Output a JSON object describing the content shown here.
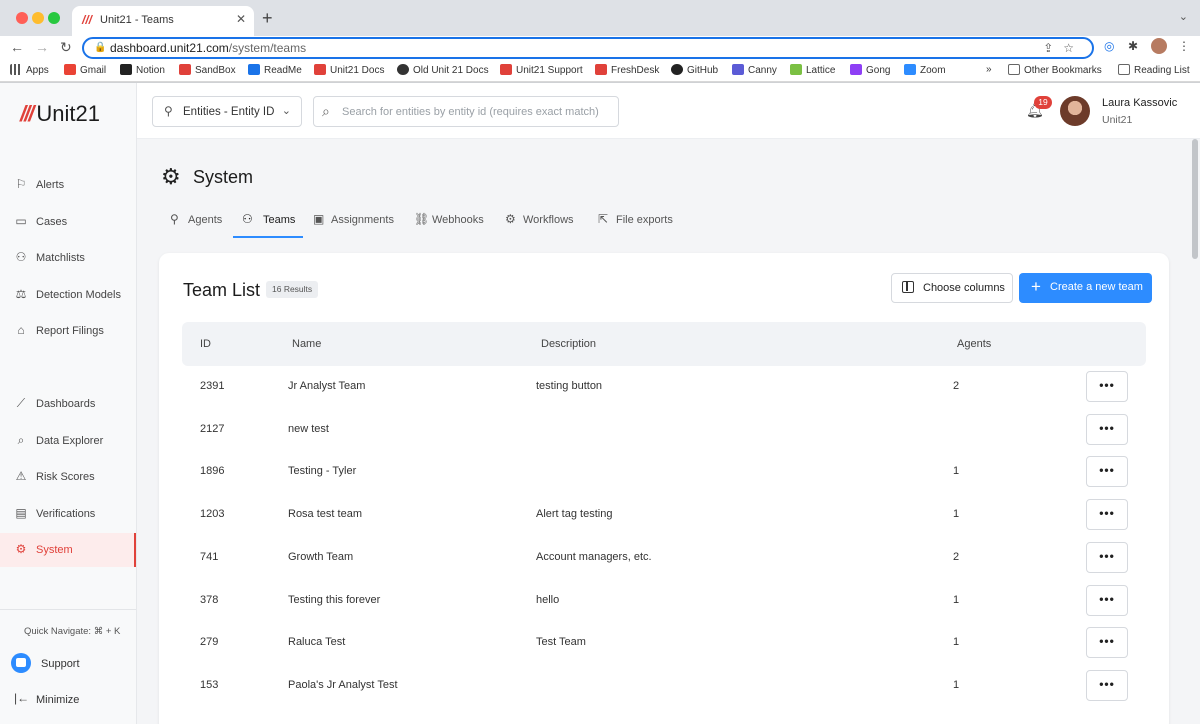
{
  "browser": {
    "tab_title": "Unit21 - Teams",
    "tab_favicon": "///",
    "new_tab": "+",
    "tab_close": "✕",
    "tab_menu": "⌄",
    "url_host": "dashboard.unit21.com",
    "url_path": "/system/teams",
    "bookmarks": [
      {
        "label": "Apps",
        "color": "#4285f4"
      },
      {
        "label": "Gmail",
        "color": "#ea4335"
      },
      {
        "label": "Notion",
        "color": "#222222"
      },
      {
        "label": "SandBox",
        "color": "#e0413a"
      },
      {
        "label": "ReadMe",
        "color": "#1a73e8"
      },
      {
        "label": "Unit21 Docs",
        "color": "#e0413a"
      },
      {
        "label": "Old Unit 21 Docs",
        "color": "#333333"
      },
      {
        "label": "Unit21 Support",
        "color": "#e0413a"
      },
      {
        "label": "FreshDesk",
        "color": "#e0413a"
      },
      {
        "label": "GitHub",
        "color": "#222222"
      },
      {
        "label": "Canny",
        "color": "#5b5bd6"
      },
      {
        "label": "Lattice",
        "color": "#7bc043"
      },
      {
        "label": "Gong",
        "color": "#8e3ff5"
      },
      {
        "label": "Zoom",
        "color": "#2d8cff"
      }
    ],
    "bookmarks_overflow": "»",
    "other_bookmarks": "Other Bookmarks",
    "reading_list": "Reading List"
  },
  "app": {
    "logo_text": "Unit21",
    "logo_mark": "///",
    "accent": "#e0413a",
    "primary": "#2d8cff"
  },
  "sidebar": {
    "items_top": [
      {
        "label": "Alerts",
        "icon": "flag-icon"
      },
      {
        "label": "Cases",
        "icon": "briefcase-icon"
      },
      {
        "label": "Matchlists",
        "icon": "user-plus-icon"
      },
      {
        "label": "Detection Models",
        "icon": "scale-icon"
      },
      {
        "label": "Report Filings",
        "icon": "bank-icon"
      }
    ],
    "items_bottom": [
      {
        "label": "Dashboards",
        "icon": "chart-line-icon"
      },
      {
        "label": "Data Explorer",
        "icon": "search-list-icon"
      },
      {
        "label": "Risk Scores",
        "icon": "warning-icon"
      },
      {
        "label": "Verifications",
        "icon": "id-card-icon"
      },
      {
        "label": "System",
        "icon": "gear-icon",
        "active": true
      }
    ],
    "quick_navigate": "Quick Navigate: ⌘ + K",
    "support": "Support",
    "minimize": "Minimize"
  },
  "header": {
    "entity_select": "Entities - Entity ID",
    "search_placeholder": "Search for entities by entity id (requires exact match)",
    "notifications_count": "19",
    "user_name": "Laura Kassovic",
    "user_org": "Unit21"
  },
  "page": {
    "title": "System",
    "tabs": [
      "Agents",
      "Teams",
      "Assignments",
      "Webhooks",
      "Workflows",
      "File exports"
    ],
    "active_tab": "Teams"
  },
  "team_list": {
    "title": "Team List",
    "results": "16 Results",
    "choose_columns": "Choose columns",
    "create_button": "Create a new team",
    "columns": [
      "ID",
      "Name",
      "Description",
      "Agents"
    ],
    "rows": [
      {
        "id": "2391",
        "name": "Jr Analyst Team",
        "description": "testing button",
        "agents": "2"
      },
      {
        "id": "2127",
        "name": "new test",
        "description": "",
        "agents": ""
      },
      {
        "id": "1896",
        "name": "Testing - Tyler",
        "description": "",
        "agents": "1"
      },
      {
        "id": "1203",
        "name": "Rosa test team",
        "description": "Alert tag testing",
        "agents": "1"
      },
      {
        "id": "741",
        "name": "Growth Team",
        "description": "Account managers, etc.",
        "agents": "2"
      },
      {
        "id": "378",
        "name": "Testing this forever",
        "description": "hello",
        "agents": "1"
      },
      {
        "id": "279",
        "name": "Raluca Test",
        "description": "Test Team",
        "agents": "1"
      },
      {
        "id": "153",
        "name": "Paola's Jr Analyst Test",
        "description": "",
        "agents": "1"
      }
    ],
    "more_label": "•••"
  }
}
